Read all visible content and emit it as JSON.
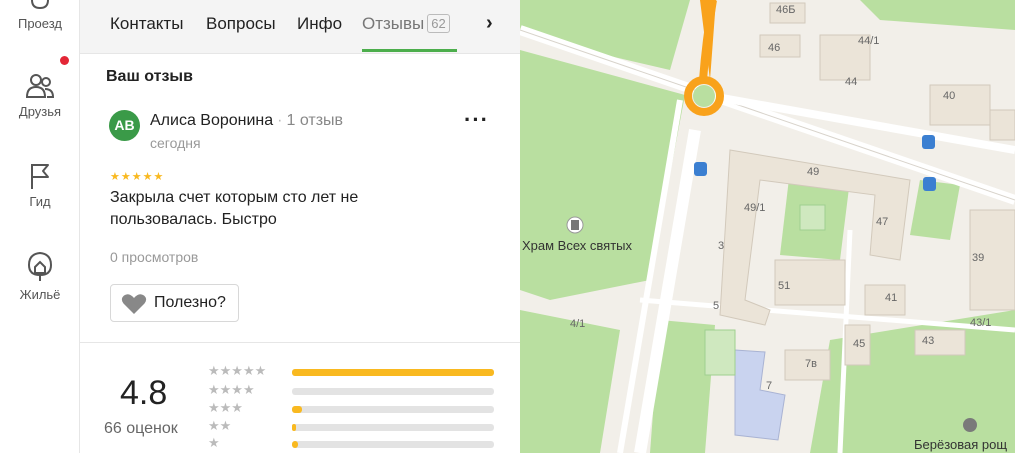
{
  "rail": {
    "items": [
      {
        "label": "Проезд",
        "icon": "route-icon"
      },
      {
        "label": "Друзья",
        "icon": "friends-icon"
      },
      {
        "label": "Гид",
        "icon": "flag-icon"
      },
      {
        "label": "Жильё",
        "icon": "house-icon"
      }
    ]
  },
  "tabs": [
    {
      "label": "Контакты"
    },
    {
      "label": "Вопросы"
    },
    {
      "label": "Инфо"
    },
    {
      "label": "Отзывы",
      "count": "62",
      "active": true
    }
  ],
  "review": {
    "section_title": "Ваш отзыв",
    "avatar_initials": "АВ",
    "author": "Алиса Воронина",
    "author_reviews": "1 отзыв",
    "date": "сегодня",
    "stars": "★★★★★",
    "text": "Закрыла счет которым сто лет не пользовалась. Быстро",
    "views": "0 просмотров",
    "useful_label": "Полезно?"
  },
  "rating": {
    "value": "4.8",
    "count_label": "66 оценок",
    "distribution": [
      {
        "stars": 5,
        "fraction": 1.0
      },
      {
        "stars": 4,
        "fraction": 0.0
      },
      {
        "stars": 3,
        "fraction": 0.05
      },
      {
        "stars": 2,
        "fraction": 0.02
      },
      {
        "stars": 1,
        "fraction": 0.03
      }
    ]
  },
  "map": {
    "labels": [
      {
        "text": "46Б"
      },
      {
        "text": "46"
      },
      {
        "text": "44/1"
      },
      {
        "text": "44"
      },
      {
        "text": "40"
      },
      {
        "text": "49"
      },
      {
        "text": "49/1"
      },
      {
        "text": "47"
      },
      {
        "text": "3"
      },
      {
        "text": "51"
      },
      {
        "text": "5"
      },
      {
        "text": "41"
      },
      {
        "text": "39"
      },
      {
        "text": "43/1"
      },
      {
        "text": "45"
      },
      {
        "text": "43"
      },
      {
        "text": "7в"
      },
      {
        "text": "7"
      },
      {
        "text": "4/1"
      }
    ],
    "poi": "Храм Всех святых",
    "park": "Берёзовая рощ",
    "colors": {
      "route": "#f9a21b",
      "green": "#b9dfa0",
      "building": "#ebe4d8"
    }
  }
}
